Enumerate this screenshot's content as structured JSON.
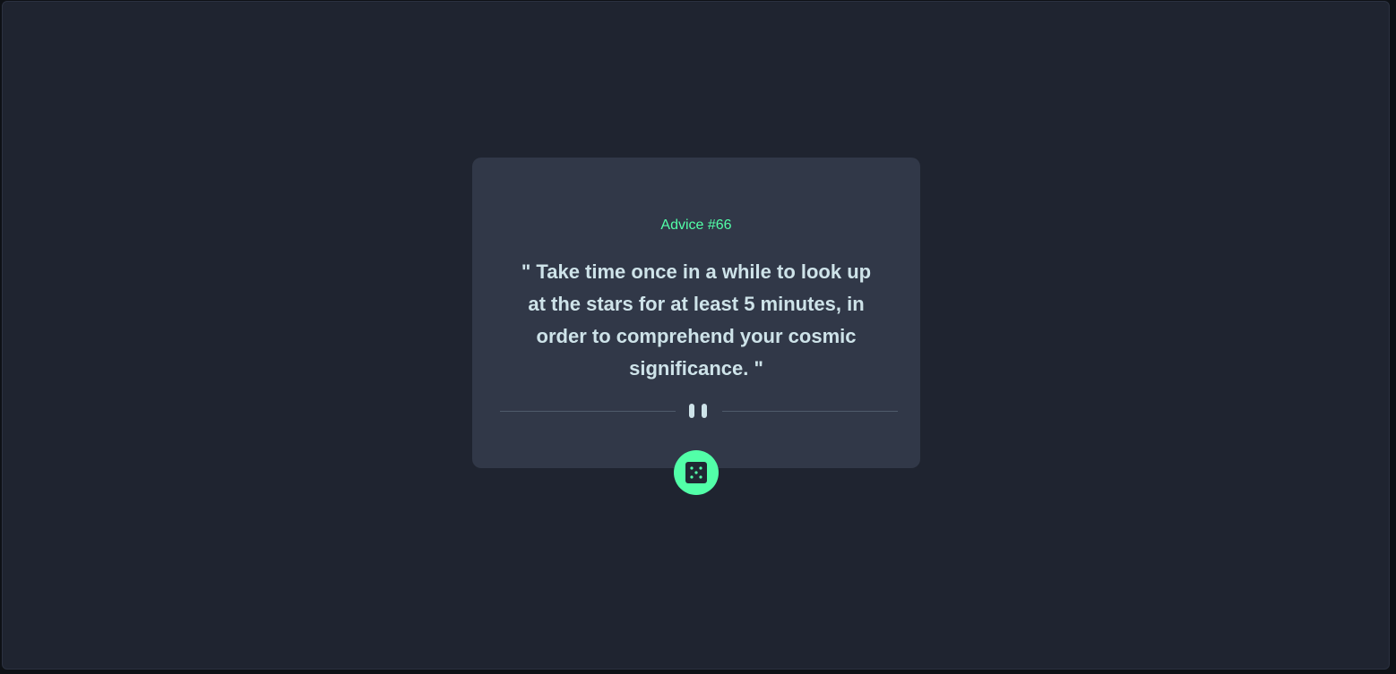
{
  "advice": {
    "id_label": "Advice #66",
    "text": "\" Take time once in a while to look up at the stars for at least 5 minutes, in order to comprehend your cosmic significance. \""
  },
  "icons": {
    "divider": "pause-icon",
    "button": "dice-icon"
  },
  "colors": {
    "background": "#1f2430",
    "card": "#313848",
    "accent": "#52ffa8",
    "text": "#cee3e9"
  }
}
